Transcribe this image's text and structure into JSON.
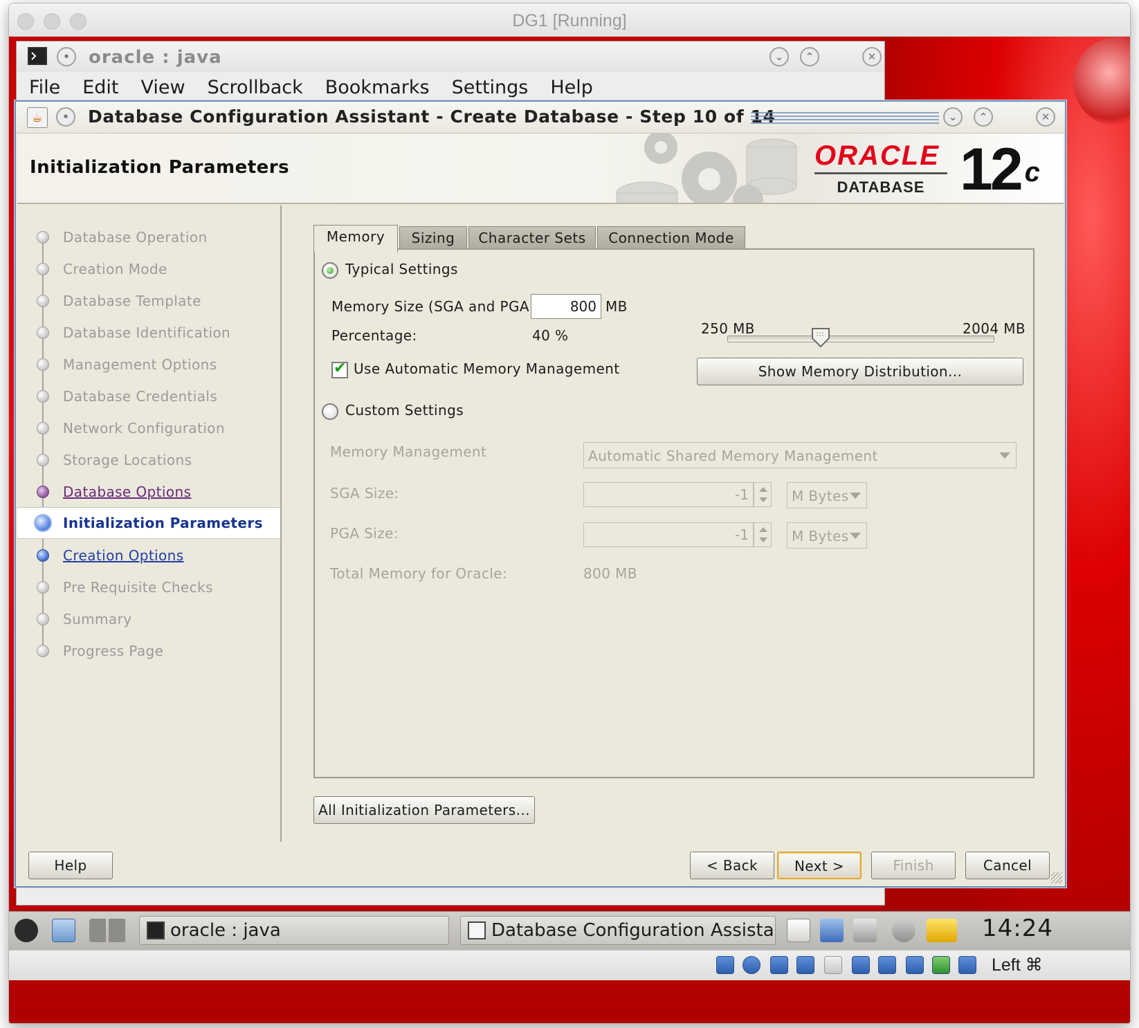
{
  "host_window": {
    "title": "DG1 [Running]"
  },
  "terminal": {
    "title": "oracle : java",
    "menu": [
      "File",
      "Edit",
      "View",
      "Scrollback",
      "Bookmarks",
      "Settings",
      "Help"
    ]
  },
  "dialog": {
    "title": "Database Configuration Assistant - Create Database - Step 10 of 14",
    "banner_title": "Initialization Parameters",
    "brand": {
      "oracle": "ORACLE",
      "database": "DATABASE",
      "version": "12",
      "version_suffix": "c",
      "color": "#e2001a"
    },
    "steps": [
      {
        "label": "Database Operation",
        "state": "disabled"
      },
      {
        "label": "Creation Mode",
        "state": "disabled"
      },
      {
        "label": "Database Template",
        "state": "disabled"
      },
      {
        "label": "Database Identification",
        "state": "disabled"
      },
      {
        "label": "Management Options",
        "state": "disabled"
      },
      {
        "label": "Database Credentials",
        "state": "disabled"
      },
      {
        "label": "Network Configuration",
        "state": "disabled"
      },
      {
        "label": "Storage Locations",
        "state": "disabled"
      },
      {
        "label": "Database Options",
        "state": "visited"
      },
      {
        "label": "Initialization Parameters",
        "state": "current"
      },
      {
        "label": "Creation Options",
        "state": "link"
      },
      {
        "label": "Pre Requisite Checks",
        "state": "disabled"
      },
      {
        "label": "Summary",
        "state": "disabled"
      },
      {
        "label": "Progress Page",
        "state": "disabled"
      }
    ],
    "tabs": [
      "Memory",
      "Sizing",
      "Character Sets",
      "Connection Mode"
    ],
    "active_tab": "Memory",
    "memory": {
      "typical_label": "Typical Settings",
      "typical_selected": true,
      "memory_size_label": "Memory Size (SGA and PGA):",
      "memory_size_value": "800",
      "memory_size_unit": "MB",
      "slider_min_label": "250 MB",
      "slider_max_label": "2004 MB",
      "slider_min": 250,
      "slider_max": 2004,
      "slider_value": 800,
      "percentage_label": "Percentage:",
      "percentage_value": "40 %",
      "amm_label": "Use Automatic Memory Management",
      "amm_checked": true,
      "show_distribution_button": "Show Memory Distribution...",
      "custom_label": "Custom Settings",
      "custom_selected": false,
      "memory_management_label": "Memory Management",
      "memory_management_value": "Automatic Shared Memory Management",
      "sga_size_label": "SGA Size:",
      "sga_size_value": "-1",
      "sga_unit": "M Bytes",
      "pga_size_label": "PGA Size:",
      "pga_size_value": "-1",
      "pga_unit": "M Bytes",
      "total_memory_label": "Total Memory for Oracle:",
      "total_memory_value": "800 MB"
    },
    "all_params_button": "All Initialization Parameters...",
    "buttons": {
      "help": "Help",
      "back": "< Back",
      "next": "Next >",
      "finish": "Finish",
      "cancel": "Cancel"
    }
  },
  "taskbar": {
    "items": [
      "oracle : java",
      "Database Configuration Assista"
    ],
    "clock": "14:24"
  },
  "vbox_status": {
    "host_key": "Left ⌘"
  }
}
